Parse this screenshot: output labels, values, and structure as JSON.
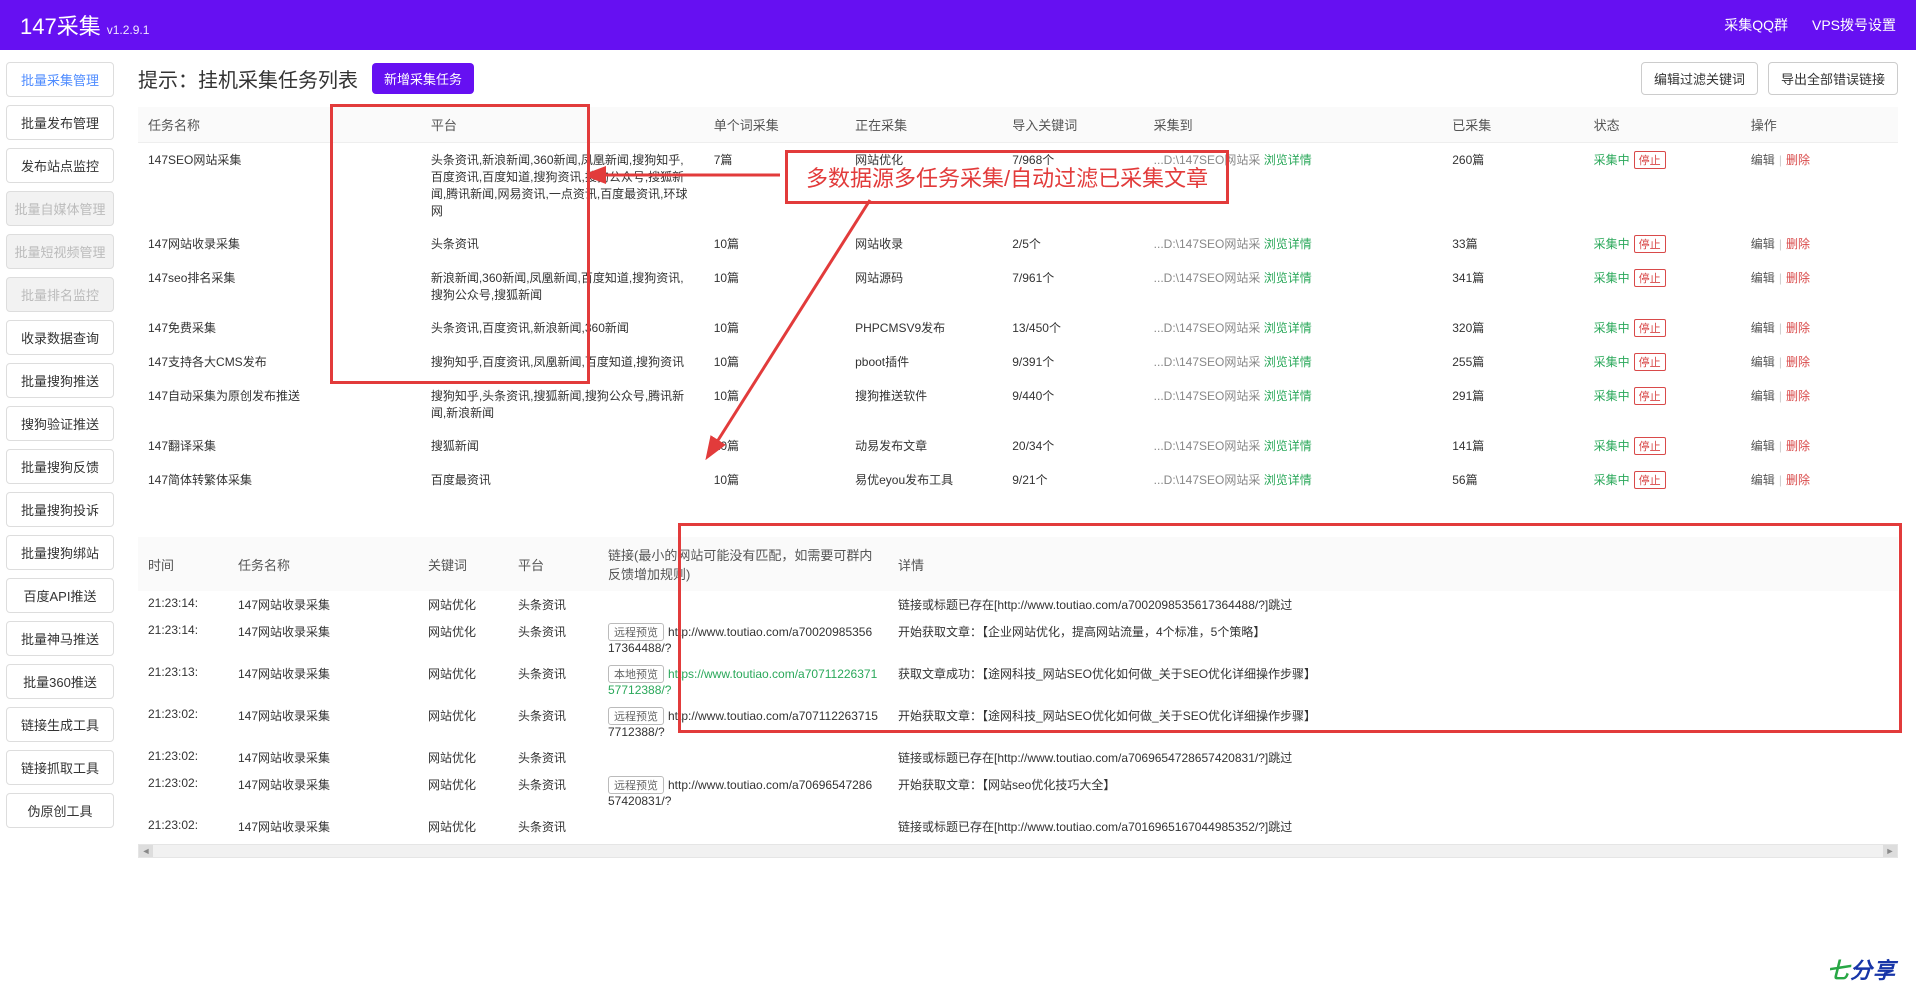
{
  "header": {
    "brand": "147采集",
    "version": "v1.2.9.1",
    "links": [
      "采集QQ群",
      "VPS拨号设置"
    ]
  },
  "sidebar": [
    {
      "label": "批量采集管理",
      "active": true
    },
    {
      "label": "批量发布管理"
    },
    {
      "label": "发布站点监控"
    },
    {
      "label": "批量自媒体管理",
      "disabled": true
    },
    {
      "label": "批量短视频管理",
      "disabled": true
    },
    {
      "label": "批量排名监控",
      "disabled": true
    },
    {
      "label": "收录数据查询"
    },
    {
      "label": "批量搜狗推送"
    },
    {
      "label": "搜狗验证推送"
    },
    {
      "label": "批量搜狗反馈"
    },
    {
      "label": "批量搜狗投诉"
    },
    {
      "label": "批量搜狗绑站"
    },
    {
      "label": "百度API推送"
    },
    {
      "label": "批量神马推送"
    },
    {
      "label": "批量360推送"
    },
    {
      "label": "链接生成工具"
    },
    {
      "label": "链接抓取工具"
    },
    {
      "label": "伪原创工具"
    }
  ],
  "page": {
    "title": "提示：挂机采集任务列表",
    "new_task": "新增采集任务",
    "actions": [
      "编辑过滤关键词",
      "导出全部错误链接"
    ]
  },
  "task_table": {
    "headers": [
      "任务名称",
      "平台",
      "单个词采集",
      "正在采集",
      "导入关键词",
      "采集到",
      "已采集",
      "状态",
      "操作"
    ],
    "status_label": "采集中",
    "stop_label": "停止",
    "edit_label": "编辑",
    "del_label": "删除",
    "browse_label": "浏览详情",
    "rows": [
      {
        "name": "147SEO网站采集",
        "platform": "头条资讯,新浪新闻,360新闻,凤凰新闻,搜狗知乎,百度资讯,百度知道,搜狗资讯,搜狗公众号,搜狐新闻,腾讯新闻,网易资讯,一点资讯,百度最资讯,环球网",
        "per": "7篇",
        "current": "网站优化",
        "kw": "7/968个",
        "to": "...D:\\147SEO网站采",
        "count": "260篇"
      },
      {
        "name": "147网站收录采集",
        "platform": "头条资讯",
        "per": "10篇",
        "current": "网站收录",
        "kw": "2/5个",
        "to": "...D:\\147SEO网站采",
        "count": "33篇"
      },
      {
        "name": "147seo排名采集",
        "platform": "新浪新闻,360新闻,凤凰新闻,百度知道,搜狗资讯,搜狗公众号,搜狐新闻",
        "per": "10篇",
        "current": "网站源码",
        "kw": "7/961个",
        "to": "...D:\\147SEO网站采",
        "count": "341篇"
      },
      {
        "name": "147免费采集",
        "platform": "头条资讯,百度资讯,新浪新闻,360新闻",
        "per": "10篇",
        "current": "PHPCMSV9发布",
        "kw": "13/450个",
        "to": "...D:\\147SEO网站采",
        "count": "320篇"
      },
      {
        "name": "147支持各大CMS发布",
        "platform": "搜狗知乎,百度资讯,凤凰新闻,百度知道,搜狗资讯",
        "per": "10篇",
        "current": "pboot插件",
        "kw": "9/391个",
        "to": "...D:\\147SEO网站采",
        "count": "255篇"
      },
      {
        "name": "147自动采集为原创发布推送",
        "platform": "搜狗知乎,头条资讯,搜狐新闻,搜狗公众号,腾讯新闻,新浪新闻",
        "per": "10篇",
        "current": "搜狗推送软件",
        "kw": "9/440个",
        "to": "...D:\\147SEO网站采",
        "count": "291篇"
      },
      {
        "name": "147翻译采集",
        "platform": "搜狐新闻",
        "per": "10篇",
        "current": "动易发布文章",
        "kw": "20/34个",
        "to": "...D:\\147SEO网站采",
        "count": "141篇"
      },
      {
        "name": "147简体转繁体采集",
        "platform": "百度最资讯",
        "per": "10篇",
        "current": "易优eyou发布工具",
        "kw": "9/21个",
        "to": "...D:\\147SEO网站采",
        "count": "56篇"
      }
    ]
  },
  "callout": "多数据源多任务采集/自动过滤已采集文章",
  "log_table": {
    "headers": [
      "时间",
      "任务名称",
      "关键词",
      "平台",
      "链接(最小的网站可能没有匹配，如需要可群内反馈增加规则)",
      "详情"
    ],
    "remote_label": "远程预览",
    "local_label": "本地预览",
    "rows": [
      {
        "time": "21:23:14:",
        "task": "147网站收录采集",
        "kw": "网站优化",
        "plat": "头条资讯",
        "link": "",
        "detail": "链接或标题已存在[http://www.toutiao.com/a7002098535617364488/?]跳过"
      },
      {
        "time": "21:23:14:",
        "task": "147网站收录采集",
        "kw": "网站优化",
        "plat": "头条资讯",
        "btn": "remote",
        "link": "http://www.toutiao.com/a7002098535617364488/?",
        "detail": "开始获取文章：【企业网站优化，提高网站流量，4个标准，5个策略】"
      },
      {
        "time": "21:23:13:",
        "task": "147网站收录采集",
        "kw": "网站优化",
        "plat": "头条资讯",
        "btn": "local",
        "link": "https://www.toutiao.com/a7071122637157712388/?",
        "green": true,
        "detail": "获取文章成功：【途网科技_网站SEO优化如何做_关于SEO优化详细操作步骤】"
      },
      {
        "time": "21:23:02:",
        "task": "147网站收录采集",
        "kw": "网站优化",
        "plat": "头条资讯",
        "btn": "remote",
        "link": "http://www.toutiao.com/a7071122637157712388/?",
        "detail": "开始获取文章：【途网科技_网站SEO优化如何做_关于SEO优化详细操作步骤】"
      },
      {
        "time": "21:23:02:",
        "task": "147网站收录采集",
        "kw": "网站优化",
        "plat": "头条资讯",
        "link": "",
        "detail": "链接或标题已存在[http://www.toutiao.com/a7069654728657420831/?]跳过"
      },
      {
        "time": "21:23:02:",
        "task": "147网站收录采集",
        "kw": "网站优化",
        "plat": "头条资讯",
        "btn": "remote",
        "link": "http://www.toutiao.com/a7069654728657420831/?",
        "detail": "开始获取文章：【网站seo优化技巧大全】"
      },
      {
        "time": "21:23:02:",
        "task": "147网站收录采集",
        "kw": "网站优化",
        "plat": "头条资讯",
        "link": "",
        "detail": "链接或标题已存在[http://www.toutiao.com/a7016965167044985352/?]跳过"
      }
    ]
  },
  "watermark": {
    "a": "七",
    "b": "分享"
  }
}
